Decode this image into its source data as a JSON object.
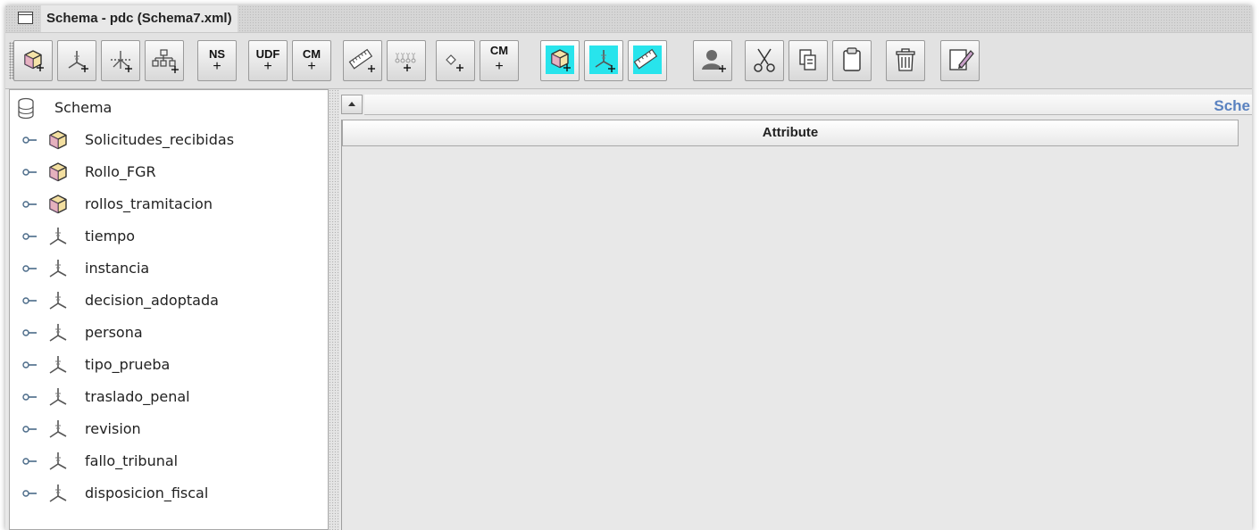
{
  "window": {
    "title": "Schema - pdc (Schema7.xml)"
  },
  "toolbar": {
    "buttons": [
      {
        "name": "add-cube-button",
        "icon": "cube-add-icon"
      },
      {
        "name": "add-dimension-button",
        "icon": "dimension-add-icon"
      },
      {
        "name": "add-dimension-usage-button",
        "icon": "dimension-usage-add-icon"
      },
      {
        "name": "add-hierarchy-button",
        "icon": "hierarchy-add-icon"
      },
      {
        "name": "add-named-set-button",
        "text": "NS",
        "icon": "named-set-add-icon"
      },
      {
        "name": "add-udf-button",
        "text": "UDF",
        "icon": "udf-add-icon"
      },
      {
        "name": "add-calculated-member-button",
        "text": "CM",
        "icon": "calculated-member-add-icon"
      },
      {
        "name": "add-measure-button",
        "icon": "measure-add-icon"
      },
      {
        "name": "add-level-button",
        "icon": "level-add-icon"
      },
      {
        "name": "add-property-button",
        "icon": "property-add-icon"
      },
      {
        "name": "add-cube-calculated-member-button",
        "text": "CM",
        "icon": "cube-calculated-member-add-icon"
      },
      {
        "name": "add-virtual-cube-button",
        "icon": "virtual-cube-add-icon",
        "active": true
      },
      {
        "name": "add-virtual-dimension-button",
        "icon": "virtual-dimension-add-icon",
        "active": true
      },
      {
        "name": "add-virtual-measure-button",
        "icon": "virtual-measure-add-icon",
        "active": true
      },
      {
        "name": "add-role-button",
        "icon": "role-add-icon"
      },
      {
        "name": "cut-button",
        "icon": "scissors-icon"
      },
      {
        "name": "copy-button",
        "icon": "copy-icon"
      },
      {
        "name": "paste-button",
        "icon": "clipboard-icon"
      },
      {
        "name": "delete-button",
        "icon": "trash-icon"
      },
      {
        "name": "edit-button",
        "icon": "edit-icon"
      }
    ],
    "highlight_color": "#28e4ec"
  },
  "tree": {
    "root": {
      "label": "Schema",
      "icon": "database-icon"
    },
    "items": [
      {
        "label": "Solicitudes_recibidas",
        "type": "cube",
        "icon": "cube-icon"
      },
      {
        "label": "Rollo_FGR",
        "type": "cube",
        "icon": "cube-icon"
      },
      {
        "label": "rollos_tramitacion",
        "type": "cube",
        "icon": "cube-icon"
      },
      {
        "label": "tiempo",
        "type": "dimension",
        "icon": "dimension-icon"
      },
      {
        "label": "instancia",
        "type": "dimension",
        "icon": "dimension-icon"
      },
      {
        "label": "decision_adoptada",
        "type": "dimension",
        "icon": "dimension-icon"
      },
      {
        "label": "persona",
        "type": "dimension",
        "icon": "dimension-icon"
      },
      {
        "label": "tipo_prueba",
        "type": "dimension",
        "icon": "dimension-icon"
      },
      {
        "label": "traslado_penal",
        "type": "dimension",
        "icon": "dimension-icon"
      },
      {
        "label": "revision",
        "type": "dimension",
        "icon": "dimension-icon"
      },
      {
        "label": "fallo_tribunal",
        "type": "dimension",
        "icon": "dimension-icon"
      },
      {
        "label": "disposicion_fiscal",
        "type": "dimension",
        "icon": "dimension-icon"
      }
    ]
  },
  "detail": {
    "tab_title": "Sche",
    "table": {
      "columns": [
        "Attribute"
      ]
    }
  },
  "colors": {
    "cube_fill": "#f3dfa0",
    "tab_title": "#5a82c0"
  }
}
